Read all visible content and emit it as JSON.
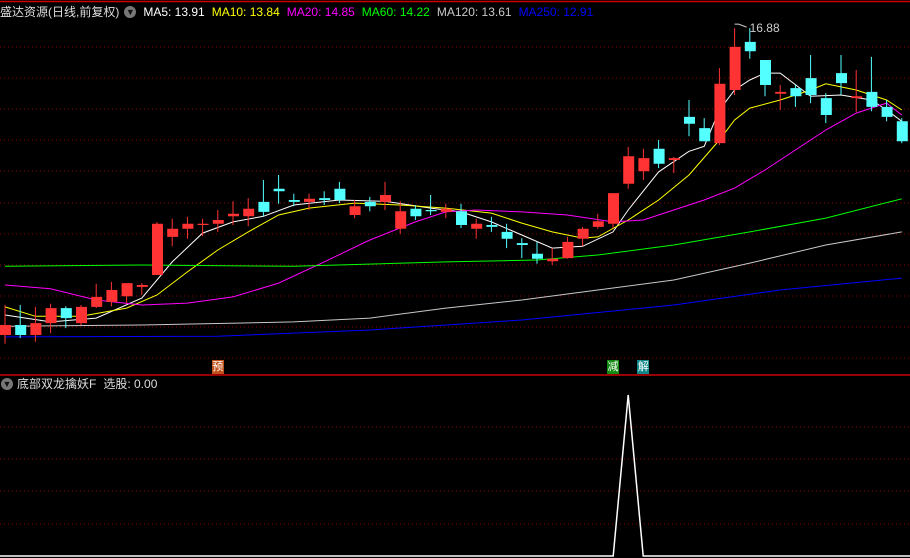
{
  "main_panel": {
    "title": "盛达资源(日线,前复权)",
    "toggle_icon": "chevron-down-icon",
    "indicators": [
      {
        "label": "MA5: 13.91",
        "color": "#ffffff"
      },
      {
        "label": "MA10: 13.84",
        "color": "#ffff00"
      },
      {
        "label": "MA20: 14.85",
        "color": "#ff00ff"
      },
      {
        "label": "MA60: 14.22",
        "color": "#00ff00"
      },
      {
        "label": "MA120: 13.61",
        "color": "#c8c8c8"
      },
      {
        "label": "MA250: 12.91",
        "color": "#0000ff"
      }
    ],
    "high_label": "16.88",
    "markers": [
      {
        "text": "预",
        "bar": 15,
        "color": "#c0501a"
      },
      {
        "text": "减",
        "bar": 41,
        "color": "#118a11"
      },
      {
        "text": "解",
        "bar": 43,
        "color": "#118888"
      }
    ]
  },
  "sub_panel": {
    "title": "底部双龙擒妖F",
    "value_label": "选股: 0.00",
    "toggle_icon": "chevron-down-icon"
  },
  "colors": {
    "up": "#ff3333",
    "down": "#54ffff",
    "grid": "#8b0000",
    "separator": "#cc0000"
  },
  "chart_data": {
    "type": "candlestick",
    "price_range": [
      11.8,
      16.88
    ],
    "ohlc": [
      [
        11.97,
        12.13,
        12.45,
        11.83
      ],
      [
        12.13,
        11.97,
        12.45,
        11.92
      ],
      [
        11.97,
        12.16,
        12.42,
        11.86
      ],
      [
        12.16,
        12.4,
        12.47,
        12.0
      ],
      [
        12.4,
        12.24,
        12.43,
        12.08
      ],
      [
        12.16,
        12.42,
        12.45,
        12.13
      ],
      [
        12.42,
        12.58,
        12.79,
        12.4
      ],
      [
        12.5,
        12.69,
        12.82,
        12.43
      ],
      [
        12.59,
        12.8,
        12.8,
        12.48
      ],
      [
        12.74,
        12.77,
        12.8,
        12.61
      ],
      [
        12.93,
        13.75,
        13.78,
        12.93
      ],
      [
        13.54,
        13.67,
        13.83,
        13.39
      ],
      [
        13.67,
        13.75,
        13.86,
        13.51
      ],
      [
        13.73,
        13.75,
        13.83,
        13.55
      ],
      [
        13.75,
        13.81,
        13.97,
        13.62
      ],
      [
        13.87,
        13.91,
        14.11,
        13.73
      ],
      [
        13.87,
        13.99,
        14.16,
        13.71
      ],
      [
        14.1,
        13.94,
        14.45,
        13.87
      ],
      [
        14.31,
        14.27,
        14.53,
        14.07
      ],
      [
        14.13,
        14.1,
        14.23,
        14.03
      ],
      [
        14.1,
        14.15,
        14.23,
        13.97
      ],
      [
        14.16,
        14.13,
        14.27,
        14.05
      ],
      [
        14.31,
        14.13,
        14.42,
        14.08
      ],
      [
        13.89,
        14.03,
        14.13,
        13.84
      ],
      [
        14.1,
        14.03,
        14.18,
        13.95
      ],
      [
        14.1,
        14.21,
        14.42,
        13.97
      ],
      [
        13.67,
        13.95,
        14.11,
        13.59
      ],
      [
        13.99,
        13.87,
        14.05,
        13.81
      ],
      [
        13.97,
        13.95,
        14.21,
        13.89
      ],
      [
        13.94,
        13.99,
        14.07,
        13.84
      ],
      [
        13.95,
        13.73,
        14.07,
        13.68
      ],
      [
        13.67,
        13.75,
        13.83,
        13.51
      ],
      [
        13.73,
        13.7,
        13.86,
        13.62
      ],
      [
        13.62,
        13.51,
        13.75,
        13.36
      ],
      [
        13.44,
        13.41,
        13.52,
        13.2
      ],
      [
        13.27,
        13.19,
        13.46,
        13.11
      ],
      [
        13.15,
        13.19,
        13.36,
        13.09
      ],
      [
        13.2,
        13.46,
        13.54,
        13.19
      ],
      [
        13.51,
        13.67,
        13.7,
        13.39
      ],
      [
        13.7,
        13.79,
        13.91,
        13.67
      ],
      [
        13.75,
        14.24,
        14.24,
        13.68
      ],
      [
        14.39,
        14.83,
        14.98,
        14.31
      ],
      [
        14.59,
        14.8,
        14.95,
        14.45
      ],
      [
        14.95,
        14.71,
        15.09,
        14.64
      ],
      [
        14.77,
        14.8,
        14.82,
        14.56
      ],
      [
        15.46,
        15.35,
        15.73,
        15.15
      ],
      [
        15.28,
        15.07,
        15.44,
        15.07
      ],
      [
        15.04,
        15.99,
        16.24,
        15.01
      ],
      [
        15.89,
        16.58,
        16.88,
        15.81
      ],
      [
        16.66,
        16.51,
        16.88,
        16.39
      ],
      [
        16.37,
        15.97,
        16.37,
        15.79
      ],
      [
        15.83,
        15.86,
        15.97,
        15.57
      ],
      [
        15.92,
        15.79,
        15.97,
        15.62
      ],
      [
        16.08,
        15.81,
        16.45,
        15.68
      ],
      [
        15.76,
        15.49,
        15.84,
        15.36
      ],
      [
        16.16,
        16.0,
        16.45,
        15.81
      ],
      [
        15.76,
        15.79,
        16.21,
        15.54
      ],
      [
        15.86,
        15.62,
        16.42,
        15.55
      ],
      [
        15.62,
        15.46,
        15.73,
        15.39
      ],
      [
        15.39,
        15.07,
        15.44,
        15.04
      ]
    ],
    "ma_lines": [
      {
        "name": "MA5",
        "color": "#ffffff",
        "points": [
          [
            1,
            12.29
          ],
          [
            4,
            12.18
          ],
          [
            7,
            12.24
          ],
          [
            10,
            12.56
          ],
          [
            12,
            13.14
          ],
          [
            14,
            13.6
          ],
          [
            16,
            13.78
          ],
          [
            18,
            13.87
          ],
          [
            20,
            14.05
          ],
          [
            23,
            14.13
          ],
          [
            26,
            14.11
          ],
          [
            29,
            14.0
          ],
          [
            31,
            13.94
          ],
          [
            33,
            13.78
          ],
          [
            35,
            13.57
          ],
          [
            37,
            13.36
          ],
          [
            39,
            13.39
          ],
          [
            41,
            13.62
          ],
          [
            42,
            13.97
          ],
          [
            44,
            14.58
          ],
          [
            46,
            14.91
          ],
          [
            47,
            14.99
          ],
          [
            48,
            15.57
          ],
          [
            49,
            15.89
          ],
          [
            50,
            16.05
          ],
          [
            51,
            16.16
          ],
          [
            52,
            16.16
          ],
          [
            54,
            15.79
          ],
          [
            56,
            15.81
          ],
          [
            58,
            15.73
          ],
          [
            59,
            15.57
          ],
          [
            60,
            15.39
          ]
        ]
      },
      {
        "name": "MA10",
        "color": "#ffff00",
        "points": [
          [
            1,
            12.42
          ],
          [
            3,
            12.27
          ],
          [
            6,
            12.27
          ],
          [
            9,
            12.4
          ],
          [
            11,
            12.61
          ],
          [
            13,
            12.98
          ],
          [
            15,
            13.33
          ],
          [
            17,
            13.62
          ],
          [
            19,
            13.89
          ],
          [
            21,
            14.0
          ],
          [
            24,
            14.08
          ],
          [
            27,
            14.05
          ],
          [
            30,
            14.0
          ],
          [
            33,
            13.92
          ],
          [
            35,
            13.76
          ],
          [
            37,
            13.62
          ],
          [
            39,
            13.52
          ],
          [
            40,
            13.54
          ],
          [
            42,
            13.81
          ],
          [
            44,
            14.13
          ],
          [
            46,
            14.53
          ],
          [
            48,
            15.09
          ],
          [
            49,
            15.41
          ],
          [
            50,
            15.6
          ],
          [
            52,
            15.73
          ],
          [
            54,
            15.89
          ],
          [
            55,
            15.99
          ],
          [
            57,
            15.89
          ],
          [
            59,
            15.73
          ],
          [
            60,
            15.57
          ]
        ]
      },
      {
        "name": "MA20",
        "color": "#ff00ff",
        "points": [
          [
            1,
            12.77
          ],
          [
            4,
            12.71
          ],
          [
            7,
            12.53
          ],
          [
            10,
            12.45
          ],
          [
            13,
            12.48
          ],
          [
            16,
            12.58
          ],
          [
            19,
            12.8
          ],
          [
            22,
            13.14
          ],
          [
            25,
            13.49
          ],
          [
            28,
            13.78
          ],
          [
            30,
            13.94
          ],
          [
            32,
            13.97
          ],
          [
            35,
            13.94
          ],
          [
            38,
            13.89
          ],
          [
            41,
            13.78
          ],
          [
            43,
            13.81
          ],
          [
            45,
            13.97
          ],
          [
            47,
            14.13
          ],
          [
            49,
            14.32
          ],
          [
            51,
            14.61
          ],
          [
            53,
            14.93
          ],
          [
            55,
            15.25
          ],
          [
            57,
            15.52
          ],
          [
            59,
            15.68
          ],
          [
            60,
            15.49
          ]
        ]
      },
      {
        "name": "MA60",
        "color": "#00ff00",
        "points": [
          [
            1,
            13.07
          ],
          [
            10,
            13.09
          ],
          [
            20,
            13.07
          ],
          [
            30,
            13.14
          ],
          [
            36,
            13.17
          ],
          [
            40,
            13.25
          ],
          [
            45,
            13.41
          ],
          [
            50,
            13.62
          ],
          [
            55,
            13.84
          ],
          [
            60,
            14.15
          ]
        ]
      },
      {
        "name": "MA120",
        "color": "#c8c8c8",
        "points": [
          [
            1,
            12.11
          ],
          [
            10,
            12.13
          ],
          [
            20,
            12.18
          ],
          [
            25,
            12.24
          ],
          [
            30,
            12.4
          ],
          [
            35,
            12.53
          ],
          [
            40,
            12.69
          ],
          [
            45,
            12.85
          ],
          [
            50,
            13.12
          ],
          [
            55,
            13.41
          ],
          [
            60,
            13.62
          ]
        ]
      },
      {
        "name": "MA250",
        "color": "#0000ff",
        "points": [
          [
            1,
            11.94
          ],
          [
            15,
            11.95
          ],
          [
            25,
            12.05
          ],
          [
            35,
            12.21
          ],
          [
            45,
            12.45
          ],
          [
            52,
            12.69
          ],
          [
            60,
            12.88
          ]
        ]
      }
    ],
    "signal": {
      "name": "选股",
      "spike_bar": 42,
      "spike_value": 1,
      "baseline": 0
    }
  }
}
